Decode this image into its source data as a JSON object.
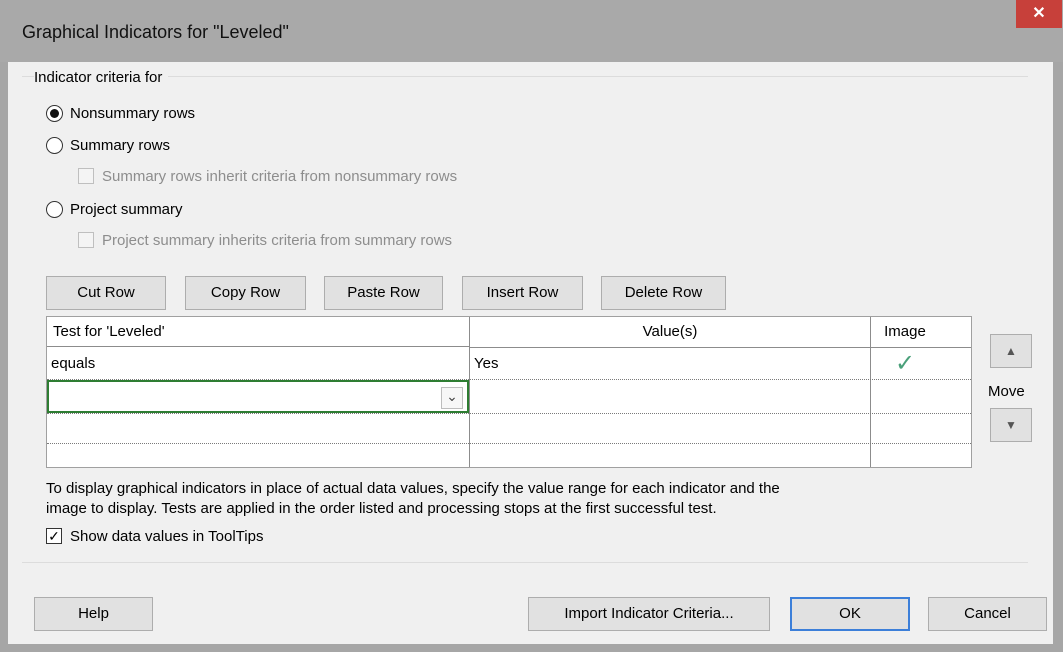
{
  "window": {
    "title": "Graphical Indicators for \"Leveled\"",
    "close_glyph": "✕"
  },
  "criteria": {
    "group_label": "Indicator criteria for",
    "nonsummary_label": "Nonsummary rows",
    "summary_label": "Summary rows",
    "summary_inherit_label": "Summary rows inherit criteria from nonsummary rows",
    "project_label": "Project summary",
    "project_inherit_label": "Project summary inherits criteria from summary rows"
  },
  "toolbar": {
    "cut": "Cut Row",
    "copy": "Copy Row",
    "paste": "Paste Row",
    "insert": "Insert Row",
    "delete": "Delete Row"
  },
  "grid": {
    "columns": [
      "Test for 'Leveled'",
      "Value(s)",
      "Image"
    ],
    "rows": [
      {
        "test": "equals",
        "value": "Yes",
        "image": "checkmark-icon"
      }
    ],
    "image_glyph": "✓",
    "dropdown_glyph": "⌄"
  },
  "move": {
    "label": "Move",
    "up_glyph": "▲",
    "down_glyph": "▼"
  },
  "info_text_line1": "To display graphical indicators in place of actual data values, specify the value range for each indicator and the",
  "info_text_line2": "image to display.  Tests are applied in the order listed and processing stops at the first successful test.",
  "tooltips_label": "Show data values in ToolTips",
  "footer": {
    "help": "Help",
    "import": "Import Indicator Criteria...",
    "ok": "OK",
    "cancel": "Cancel"
  },
  "colors": {
    "accent": "#3c7fd9",
    "close": "#c7403a",
    "check": "#4aa07a",
    "active_cell": "#2e7d32"
  }
}
